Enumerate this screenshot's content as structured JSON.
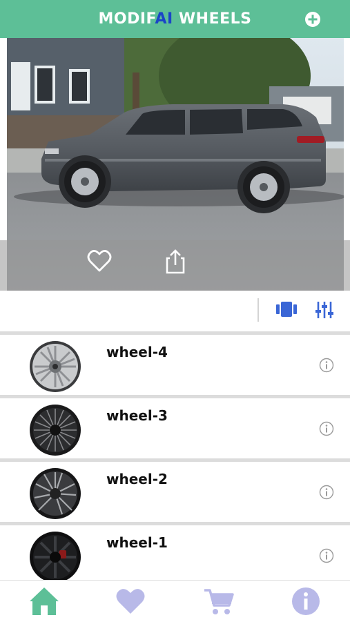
{
  "app": {
    "title_part1": "MODIF",
    "title_part2": "AI",
    "title_part3": " WHEELS"
  },
  "header": {
    "add_icon": "plus-circle-icon"
  },
  "preview": {
    "image": "gray SUV parked on street",
    "actions": [
      {
        "icon": "heart-outline-icon"
      },
      {
        "icon": "share-icon"
      }
    ]
  },
  "toolbar": {
    "compare_icon": "compare-icon",
    "filter_icon": "sliders-icon"
  },
  "wheels": [
    {
      "name": "wheel-4",
      "style": "silver-mesh"
    },
    {
      "name": "wheel-3",
      "style": "black-multispoke"
    },
    {
      "name": "wheel-2",
      "style": "black-split-spoke"
    },
    {
      "name": "wheel-1",
      "style": "black-flat"
    }
  ],
  "tabs": [
    {
      "id": "home",
      "icon": "home-icon",
      "active": true
    },
    {
      "id": "favorites",
      "icon": "heart-icon",
      "active": false
    },
    {
      "id": "cart",
      "icon": "cart-icon",
      "active": false
    },
    {
      "id": "info",
      "icon": "info-icon",
      "active": false
    }
  ],
  "colors": {
    "brand_green": "#5dbf97",
    "ai_blue": "#1a44c8",
    "icon_blue": "#3a66d6",
    "tab_inactive": "#b8b9e8",
    "tab_active": "#5dbf97"
  }
}
